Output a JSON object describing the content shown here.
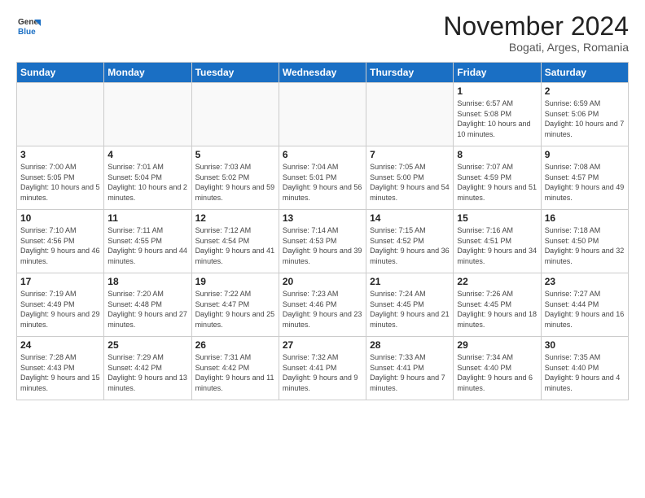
{
  "logo": {
    "general": "General",
    "blue": "Blue"
  },
  "header": {
    "month": "November 2024",
    "location": "Bogati, Arges, Romania"
  },
  "weekdays": [
    "Sunday",
    "Monday",
    "Tuesday",
    "Wednesday",
    "Thursday",
    "Friday",
    "Saturday"
  ],
  "weeks": [
    [
      {
        "day": "",
        "info": ""
      },
      {
        "day": "",
        "info": ""
      },
      {
        "day": "",
        "info": ""
      },
      {
        "day": "",
        "info": ""
      },
      {
        "day": "",
        "info": ""
      },
      {
        "day": "1",
        "info": "Sunrise: 6:57 AM\nSunset: 5:08 PM\nDaylight: 10 hours and 10 minutes."
      },
      {
        "day": "2",
        "info": "Sunrise: 6:59 AM\nSunset: 5:06 PM\nDaylight: 10 hours and 7 minutes."
      }
    ],
    [
      {
        "day": "3",
        "info": "Sunrise: 7:00 AM\nSunset: 5:05 PM\nDaylight: 10 hours and 5 minutes."
      },
      {
        "day": "4",
        "info": "Sunrise: 7:01 AM\nSunset: 5:04 PM\nDaylight: 10 hours and 2 minutes."
      },
      {
        "day": "5",
        "info": "Sunrise: 7:03 AM\nSunset: 5:02 PM\nDaylight: 9 hours and 59 minutes."
      },
      {
        "day": "6",
        "info": "Sunrise: 7:04 AM\nSunset: 5:01 PM\nDaylight: 9 hours and 56 minutes."
      },
      {
        "day": "7",
        "info": "Sunrise: 7:05 AM\nSunset: 5:00 PM\nDaylight: 9 hours and 54 minutes."
      },
      {
        "day": "8",
        "info": "Sunrise: 7:07 AM\nSunset: 4:59 PM\nDaylight: 9 hours and 51 minutes."
      },
      {
        "day": "9",
        "info": "Sunrise: 7:08 AM\nSunset: 4:57 PM\nDaylight: 9 hours and 49 minutes."
      }
    ],
    [
      {
        "day": "10",
        "info": "Sunrise: 7:10 AM\nSunset: 4:56 PM\nDaylight: 9 hours and 46 minutes."
      },
      {
        "day": "11",
        "info": "Sunrise: 7:11 AM\nSunset: 4:55 PM\nDaylight: 9 hours and 44 minutes."
      },
      {
        "day": "12",
        "info": "Sunrise: 7:12 AM\nSunset: 4:54 PM\nDaylight: 9 hours and 41 minutes."
      },
      {
        "day": "13",
        "info": "Sunrise: 7:14 AM\nSunset: 4:53 PM\nDaylight: 9 hours and 39 minutes."
      },
      {
        "day": "14",
        "info": "Sunrise: 7:15 AM\nSunset: 4:52 PM\nDaylight: 9 hours and 36 minutes."
      },
      {
        "day": "15",
        "info": "Sunrise: 7:16 AM\nSunset: 4:51 PM\nDaylight: 9 hours and 34 minutes."
      },
      {
        "day": "16",
        "info": "Sunrise: 7:18 AM\nSunset: 4:50 PM\nDaylight: 9 hours and 32 minutes."
      }
    ],
    [
      {
        "day": "17",
        "info": "Sunrise: 7:19 AM\nSunset: 4:49 PM\nDaylight: 9 hours and 29 minutes."
      },
      {
        "day": "18",
        "info": "Sunrise: 7:20 AM\nSunset: 4:48 PM\nDaylight: 9 hours and 27 minutes."
      },
      {
        "day": "19",
        "info": "Sunrise: 7:22 AM\nSunset: 4:47 PM\nDaylight: 9 hours and 25 minutes."
      },
      {
        "day": "20",
        "info": "Sunrise: 7:23 AM\nSunset: 4:46 PM\nDaylight: 9 hours and 23 minutes."
      },
      {
        "day": "21",
        "info": "Sunrise: 7:24 AM\nSunset: 4:45 PM\nDaylight: 9 hours and 21 minutes."
      },
      {
        "day": "22",
        "info": "Sunrise: 7:26 AM\nSunset: 4:45 PM\nDaylight: 9 hours and 18 minutes."
      },
      {
        "day": "23",
        "info": "Sunrise: 7:27 AM\nSunset: 4:44 PM\nDaylight: 9 hours and 16 minutes."
      }
    ],
    [
      {
        "day": "24",
        "info": "Sunrise: 7:28 AM\nSunset: 4:43 PM\nDaylight: 9 hours and 15 minutes."
      },
      {
        "day": "25",
        "info": "Sunrise: 7:29 AM\nSunset: 4:42 PM\nDaylight: 9 hours and 13 minutes."
      },
      {
        "day": "26",
        "info": "Sunrise: 7:31 AM\nSunset: 4:42 PM\nDaylight: 9 hours and 11 minutes."
      },
      {
        "day": "27",
        "info": "Sunrise: 7:32 AM\nSunset: 4:41 PM\nDaylight: 9 hours and 9 minutes."
      },
      {
        "day": "28",
        "info": "Sunrise: 7:33 AM\nSunset: 4:41 PM\nDaylight: 9 hours and 7 minutes."
      },
      {
        "day": "29",
        "info": "Sunrise: 7:34 AM\nSunset: 4:40 PM\nDaylight: 9 hours and 6 minutes."
      },
      {
        "day": "30",
        "info": "Sunrise: 7:35 AM\nSunset: 4:40 PM\nDaylight: 9 hours and 4 minutes."
      }
    ]
  ]
}
